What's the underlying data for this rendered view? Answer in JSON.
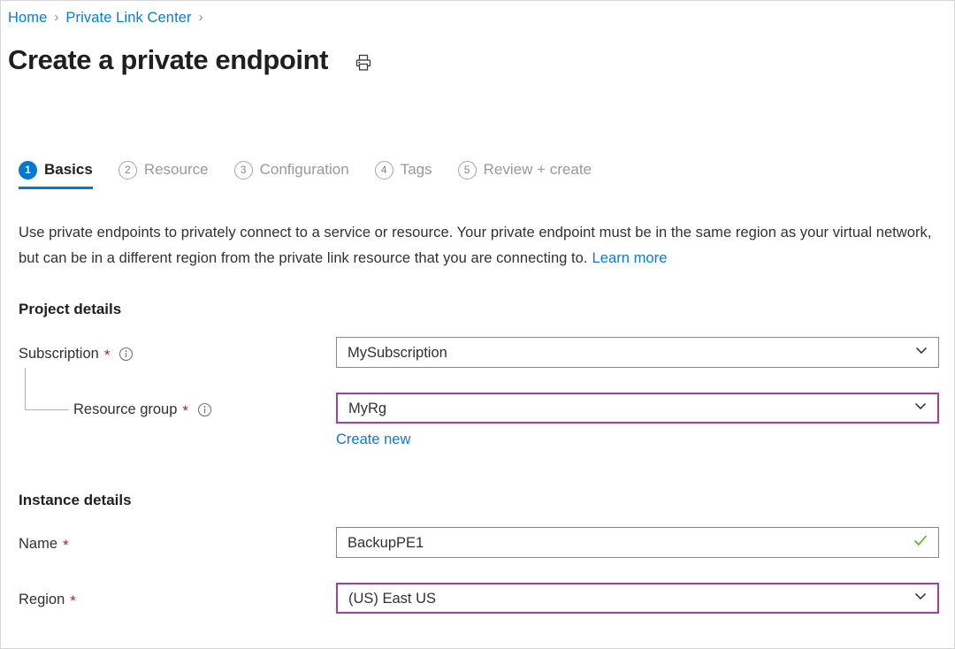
{
  "breadcrumb": {
    "items": [
      {
        "label": "Home"
      },
      {
        "label": "Private Link Center"
      }
    ],
    "separator": "›"
  },
  "header": {
    "title": "Create a private endpoint",
    "print_icon": "printer-icon"
  },
  "wizard": {
    "tabs": [
      {
        "num": "1",
        "label": "Basics",
        "state": "active"
      },
      {
        "num": "2",
        "label": "Resource",
        "state": "inactive"
      },
      {
        "num": "3",
        "label": "Configuration",
        "state": "inactive"
      },
      {
        "num": "4",
        "label": "Tags",
        "state": "inactive"
      },
      {
        "num": "5",
        "label": "Review + create",
        "state": "inactive"
      }
    ]
  },
  "description": {
    "text": "Use private endpoints to privately connect to a service or resource. Your private endpoint must be in the same region as your virtual network, but can be in a different region from the private link resource that you are connecting to.",
    "link_label": "Learn more"
  },
  "project_details": {
    "heading": "Project details",
    "subscription": {
      "label": "Subscription",
      "required_marker": "*",
      "info_icon": "info-icon",
      "value": "MySubscription",
      "chevron_icon": "chevron-down-icon"
    },
    "resource_group": {
      "label": "Resource group",
      "required_marker": "*",
      "info_icon": "info-icon",
      "value": "MyRg",
      "chevron_icon": "chevron-down-icon",
      "create_new_label": "Create new"
    }
  },
  "instance_details": {
    "heading": "Instance details",
    "name": {
      "label": "Name",
      "required_marker": "*",
      "value": "BackupPE1",
      "placeholder": "",
      "validation_icon": "checkmark-icon"
    },
    "region": {
      "label": "Region",
      "required_marker": "*",
      "value": "(US) East US",
      "chevron_icon": "chevron-down-icon"
    }
  },
  "colors": {
    "link": "#0a7bd4",
    "accent": "#0078d4",
    "required": "#a4262c",
    "focus_border": "#a33ea3",
    "normal_border": "#8a8886",
    "success": "#5cb338"
  }
}
